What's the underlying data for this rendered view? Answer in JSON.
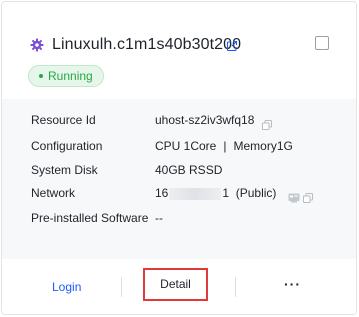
{
  "instance": {
    "name": "Linuxulh.c1m1s40b30t200",
    "status": "Running",
    "icon": "gear-icon",
    "link_icon": "external-link-icon"
  },
  "details": {
    "resource_id_label": "Resource Id",
    "resource_id_value": "uhost-sz2iv3wfq18",
    "configuration_label": "Configuration",
    "configuration_cpu": "CPU 1Core",
    "configuration_separator": "|",
    "configuration_memory": "Memory1G",
    "system_disk_label": "System Disk",
    "system_disk_value": "40GB RSSD",
    "network_label": "Network",
    "network_ip_prefix": "16",
    "network_ip_suffix": "1",
    "network_type": "(Public)",
    "preinstalled_label": "Pre-installed Software",
    "preinstalled_value": "--"
  },
  "footer": {
    "login_label": "Login",
    "detail_label": "Detail",
    "more_label": "···"
  },
  "colors": {
    "accent": "#1a5cff",
    "status_green": "#27a844",
    "highlight_red": "#e03a3a",
    "gear_purple": "#7b4fd6"
  }
}
